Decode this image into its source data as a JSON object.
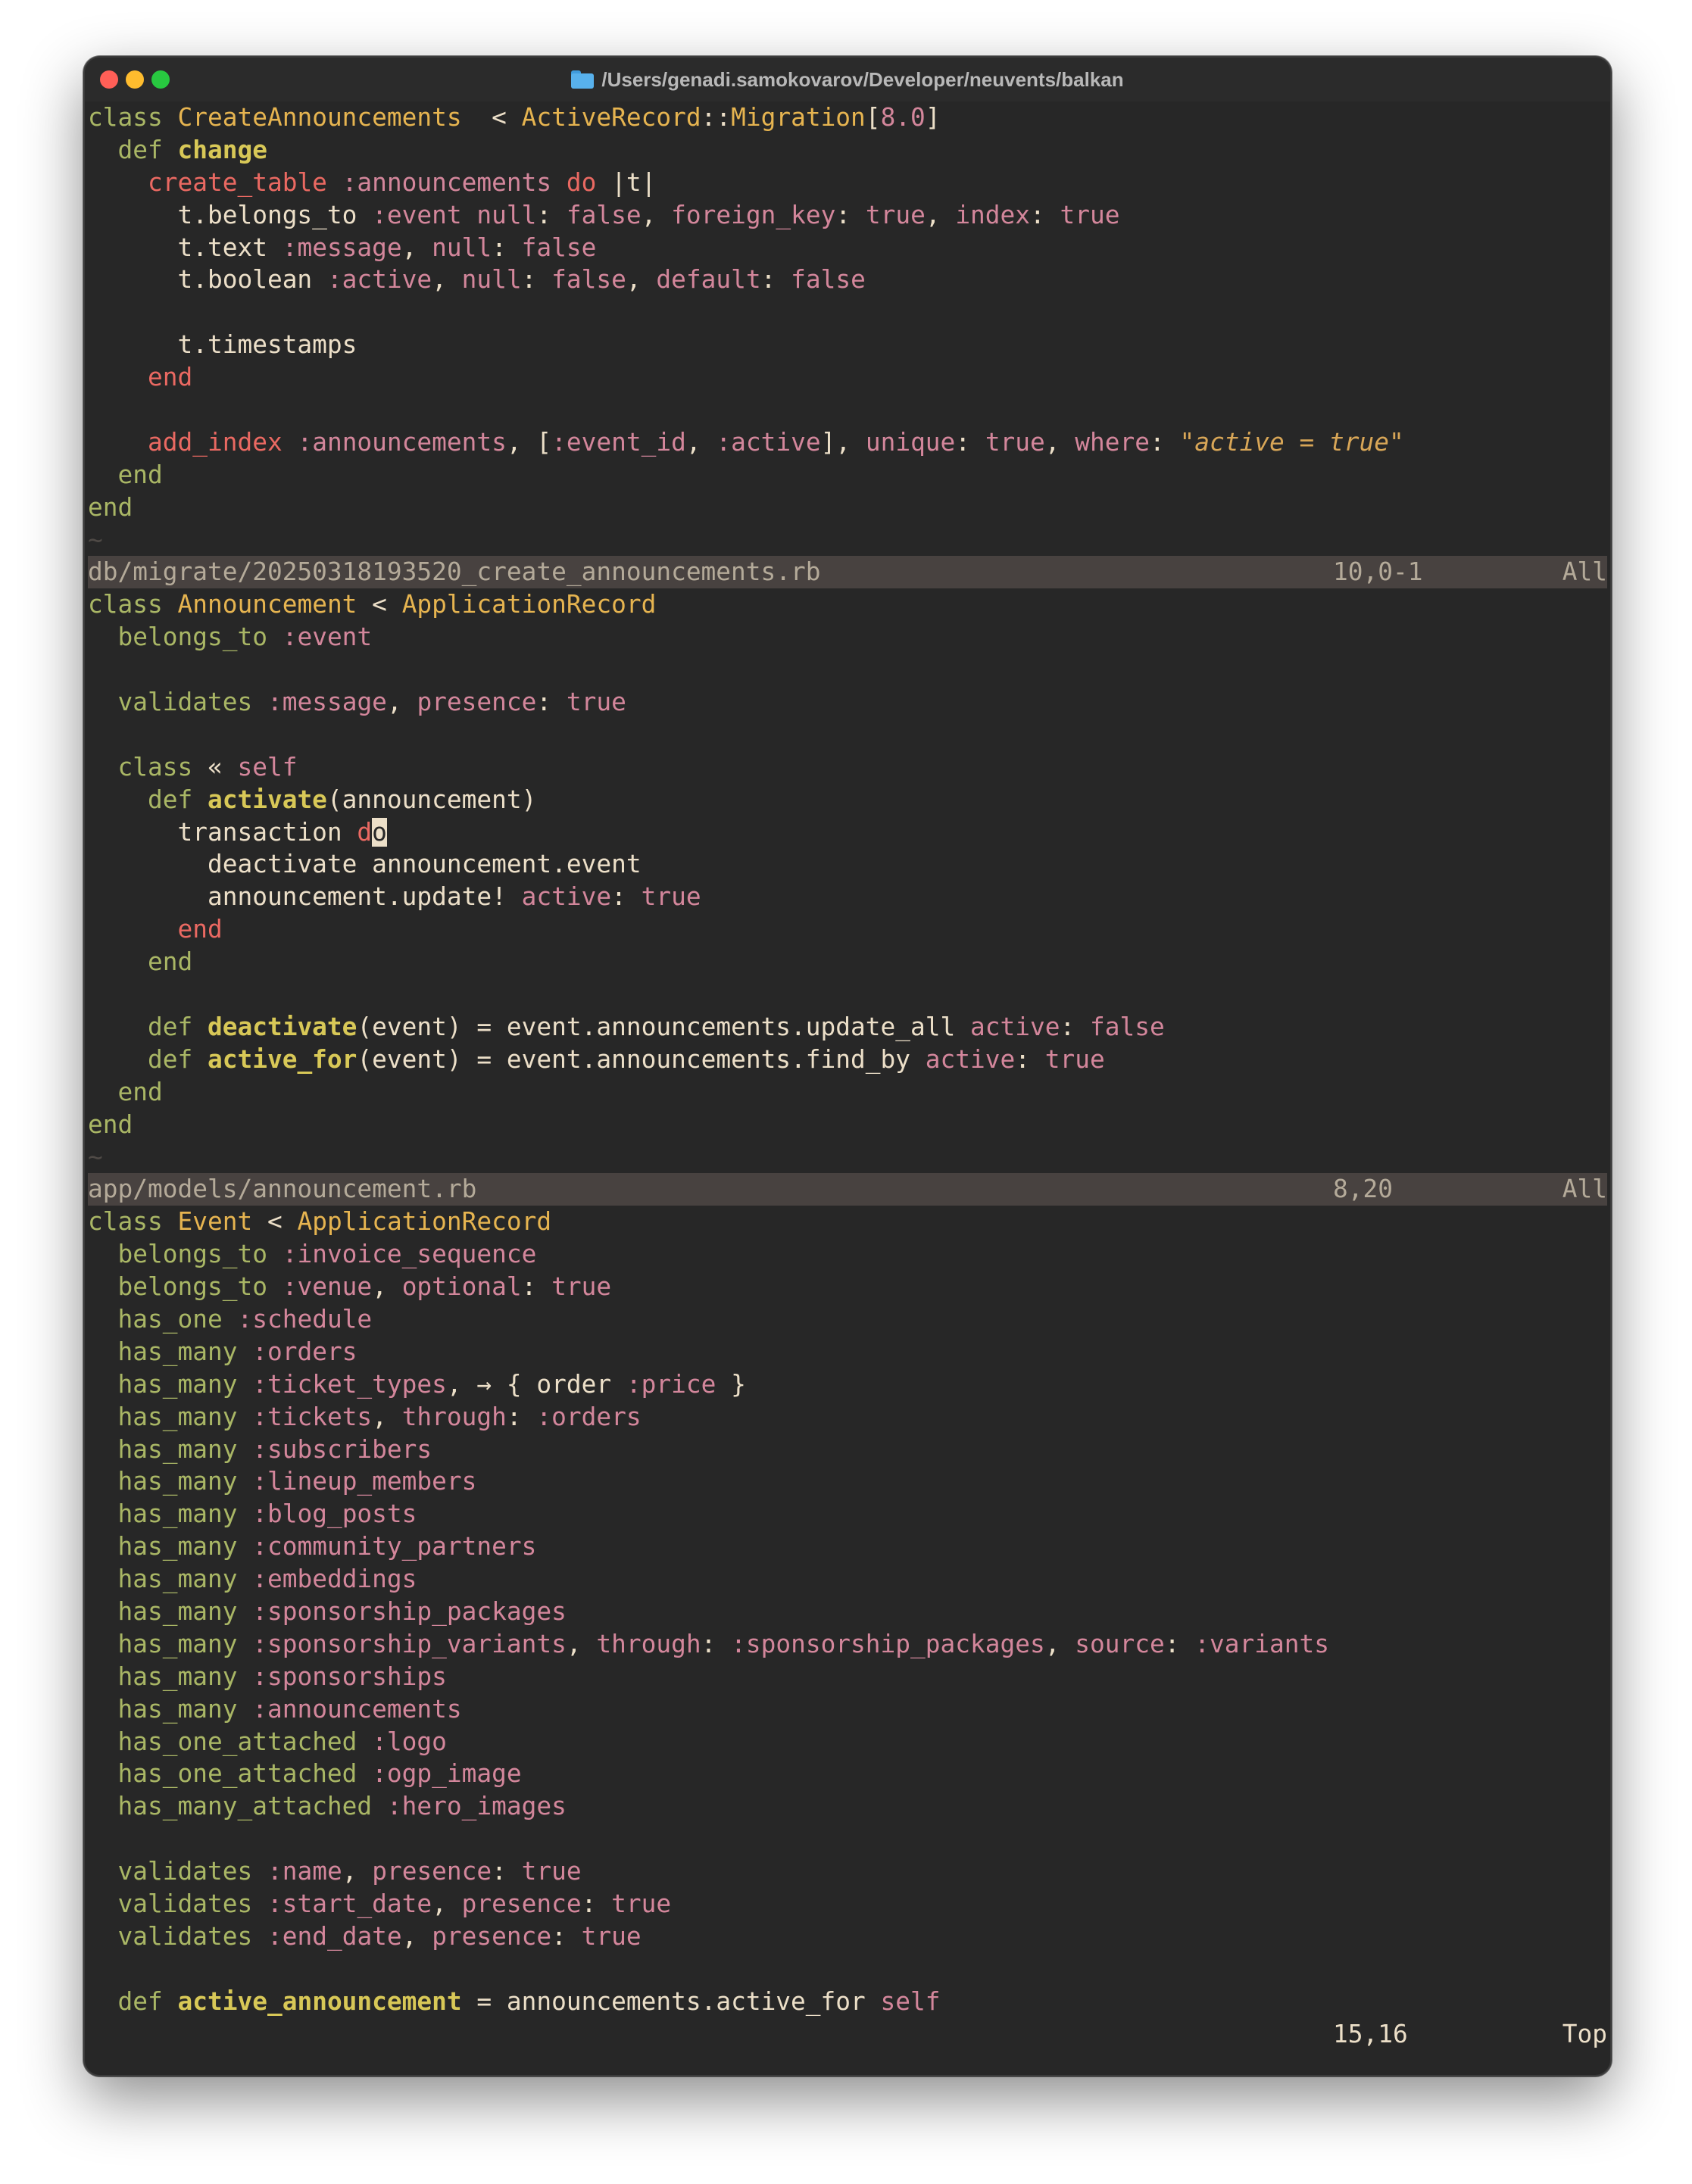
{
  "window": {
    "title": "/Users/genadi.samokovarov/Developer/neuvents/balkan"
  },
  "colors": {
    "background": "#272727",
    "statusline": "#484240",
    "keyword": "#a9b665",
    "control": "#ea6962",
    "constant": "#e6b450",
    "symbol": "#d3869b",
    "function": "#d8c857",
    "text": "#ecdfc8"
  },
  "panes": [
    {
      "filename": "db/migrate/20250318193520_create_announcements.rb",
      "position": "10,0-1",
      "scroll": "All"
    },
    {
      "filename": "app/models/announcement.rb",
      "position": "8,20",
      "scroll": "All"
    },
    {
      "filename": "",
      "position": "15,16",
      "scroll": "Top"
    }
  ],
  "code": [
    [
      [
        "kw",
        "class "
      ],
      [
        "const",
        "CreateAnnouncements"
      ],
      [
        "",
        "  < "
      ],
      [
        "const",
        "ActiveRecord"
      ],
      [
        "",
        "::"
      ],
      [
        "const",
        "Migration"
      ],
      [
        "",
        "["
      ],
      [
        "num",
        "8.0"
      ],
      [
        "",
        "]"
      ]
    ],
    [
      [
        "",
        "  "
      ],
      [
        "kw",
        "def "
      ],
      [
        "fn",
        "change"
      ]
    ],
    [
      [
        "",
        "    "
      ],
      [
        "ctl",
        "create_table "
      ],
      [
        "sym",
        ":announcements "
      ],
      [
        "ctl",
        "do "
      ],
      [
        "",
        "|t|"
      ]
    ],
    [
      [
        "",
        "      t.belongs_to "
      ],
      [
        "sym",
        ":event"
      ],
      [
        "",
        " "
      ],
      [
        "sym",
        "null"
      ],
      [
        "",
        ": "
      ],
      [
        "bool",
        "false"
      ],
      [
        "",
        ", "
      ],
      [
        "sym",
        "foreign_key"
      ],
      [
        "",
        ": "
      ],
      [
        "bool",
        "true"
      ],
      [
        "",
        ", "
      ],
      [
        "sym",
        "index"
      ],
      [
        "",
        ": "
      ],
      [
        "bool",
        "true"
      ]
    ],
    [
      [
        "",
        "      t.text "
      ],
      [
        "sym",
        ":message"
      ],
      [
        "",
        ", "
      ],
      [
        "sym",
        "null"
      ],
      [
        "",
        ": "
      ],
      [
        "bool",
        "false"
      ]
    ],
    [
      [
        "",
        "      t.boolean "
      ],
      [
        "sym",
        ":active"
      ],
      [
        "",
        ", "
      ],
      [
        "sym",
        "null"
      ],
      [
        "",
        ": "
      ],
      [
        "bool",
        "false"
      ],
      [
        "",
        ", "
      ],
      [
        "sym",
        "default"
      ],
      [
        "",
        ": "
      ],
      [
        "bool",
        "false"
      ]
    ],
    [
      [
        "",
        ""
      ]
    ],
    [
      [
        "",
        "      t.timestamps"
      ]
    ],
    [
      [
        "",
        "    "
      ],
      [
        "ctl",
        "end"
      ]
    ],
    [
      [
        "",
        ""
      ]
    ],
    [
      [
        "",
        "    "
      ],
      [
        "ctl",
        "add_index "
      ],
      [
        "sym",
        ":announcements"
      ],
      [
        "",
        ", ["
      ],
      [
        "sym",
        ":event_id"
      ],
      [
        "",
        ", "
      ],
      [
        "sym",
        ":active"
      ],
      [
        "",
        "], "
      ],
      [
        "sym",
        "unique"
      ],
      [
        "",
        ": "
      ],
      [
        "bool",
        "true"
      ],
      [
        "",
        ", "
      ],
      [
        "sym",
        "where"
      ],
      [
        "",
        ": "
      ],
      [
        "str",
        "\""
      ],
      [
        "stri",
        "active = true"
      ],
      [
        "str",
        "\""
      ]
    ],
    [
      [
        "",
        "  "
      ],
      [
        "kw",
        "end"
      ]
    ],
    [
      [
        "kw",
        "end"
      ]
    ],
    [
      [
        "tilde",
        "~"
      ]
    ],
    [
      [
        "status",
        "0"
      ]
    ],
    [
      [
        "kw",
        "class "
      ],
      [
        "const",
        "Announcement"
      ],
      [
        "",
        " < "
      ],
      [
        "const",
        "ApplicationRecord"
      ]
    ],
    [
      [
        "",
        "  "
      ],
      [
        "kw",
        "belongs_to "
      ],
      [
        "sym",
        ":event"
      ]
    ],
    [
      [
        "",
        ""
      ]
    ],
    [
      [
        "",
        "  "
      ],
      [
        "kw",
        "validates "
      ],
      [
        "sym",
        ":message"
      ],
      [
        "",
        ", "
      ],
      [
        "sym",
        "presence"
      ],
      [
        "",
        ": "
      ],
      [
        "bool",
        "true"
      ]
    ],
    [
      [
        "",
        ""
      ]
    ],
    [
      [
        "",
        "  "
      ],
      [
        "kw",
        "class "
      ],
      [
        "",
        "« "
      ],
      [
        "sym",
        "self"
      ]
    ],
    [
      [
        "",
        "    "
      ],
      [
        "kw",
        "def "
      ],
      [
        "fn",
        "activate"
      ],
      [
        "",
        "(announcement)"
      ]
    ],
    [
      [
        "",
        "      transaction "
      ],
      [
        "ctl",
        "d"
      ],
      [
        "cursor",
        "o"
      ]
    ],
    [
      [
        "",
        "        deactivate announcement.event"
      ]
    ],
    [
      [
        "",
        "        announcement.update! "
      ],
      [
        "sym",
        "active"
      ],
      [
        "",
        ": "
      ],
      [
        "bool",
        "true"
      ]
    ],
    [
      [
        "",
        "      "
      ],
      [
        "ctl",
        "end"
      ]
    ],
    [
      [
        "",
        "    "
      ],
      [
        "kw",
        "end"
      ]
    ],
    [
      [
        "",
        ""
      ]
    ],
    [
      [
        "",
        "    "
      ],
      [
        "kw",
        "def "
      ],
      [
        "fn",
        "deactivate"
      ],
      [
        "",
        "(event) = event.announcements.update_all "
      ],
      [
        "sym",
        "active"
      ],
      [
        "",
        ": "
      ],
      [
        "bool",
        "false"
      ]
    ],
    [
      [
        "",
        "    "
      ],
      [
        "kw",
        "def "
      ],
      [
        "fn",
        "active_for"
      ],
      [
        "",
        "(event) = event.announcements.find_by "
      ],
      [
        "sym",
        "active"
      ],
      [
        "",
        ": "
      ],
      [
        "bool",
        "true"
      ]
    ],
    [
      [
        "",
        "  "
      ],
      [
        "kw",
        "end"
      ]
    ],
    [
      [
        "kw",
        "end"
      ]
    ],
    [
      [
        "tilde",
        "~"
      ]
    ],
    [
      [
        "status",
        "1"
      ]
    ],
    [
      [
        "kw",
        "class "
      ],
      [
        "const",
        "Event"
      ],
      [
        "",
        " < "
      ],
      [
        "const",
        "ApplicationRecord"
      ]
    ],
    [
      [
        "",
        "  "
      ],
      [
        "kw",
        "belongs_to "
      ],
      [
        "sym",
        ":invoice_sequence"
      ]
    ],
    [
      [
        "",
        "  "
      ],
      [
        "kw",
        "belongs_to "
      ],
      [
        "sym",
        ":venue"
      ],
      [
        "",
        ", "
      ],
      [
        "sym",
        "optional"
      ],
      [
        "",
        ": "
      ],
      [
        "bool",
        "true"
      ]
    ],
    [
      [
        "",
        "  "
      ],
      [
        "kw",
        "has_one "
      ],
      [
        "sym",
        ":schedule"
      ]
    ],
    [
      [
        "",
        "  "
      ],
      [
        "kw",
        "has_many "
      ],
      [
        "sym",
        ":orders"
      ]
    ],
    [
      [
        "",
        "  "
      ],
      [
        "kw",
        "has_many "
      ],
      [
        "sym",
        ":ticket_types"
      ],
      [
        "",
        ", → { order "
      ],
      [
        "sym",
        ":price"
      ],
      [
        "",
        " }"
      ]
    ],
    [
      [
        "",
        "  "
      ],
      [
        "kw",
        "has_many "
      ],
      [
        "sym",
        ":tickets"
      ],
      [
        "",
        ", "
      ],
      [
        "sym",
        "through"
      ],
      [
        "",
        ": "
      ],
      [
        "sym",
        ":orders"
      ]
    ],
    [
      [
        "",
        "  "
      ],
      [
        "kw",
        "has_many "
      ],
      [
        "sym",
        ":subscribers"
      ]
    ],
    [
      [
        "",
        "  "
      ],
      [
        "kw",
        "has_many "
      ],
      [
        "sym",
        ":lineup_members"
      ]
    ],
    [
      [
        "",
        "  "
      ],
      [
        "kw",
        "has_many "
      ],
      [
        "sym",
        ":blog_posts"
      ]
    ],
    [
      [
        "",
        "  "
      ],
      [
        "kw",
        "has_many "
      ],
      [
        "sym",
        ":community_partners"
      ]
    ],
    [
      [
        "",
        "  "
      ],
      [
        "kw",
        "has_many "
      ],
      [
        "sym",
        ":embeddings"
      ]
    ],
    [
      [
        "",
        "  "
      ],
      [
        "kw",
        "has_many "
      ],
      [
        "sym",
        ":sponsorship_packages"
      ]
    ],
    [
      [
        "",
        "  "
      ],
      [
        "kw",
        "has_many "
      ],
      [
        "sym",
        ":sponsorship_variants"
      ],
      [
        "",
        ", "
      ],
      [
        "sym",
        "through"
      ],
      [
        "",
        ": "
      ],
      [
        "sym",
        ":sponsorship_packages"
      ],
      [
        "",
        ", "
      ],
      [
        "sym",
        "source"
      ],
      [
        "",
        ": "
      ],
      [
        "sym",
        ":variants"
      ]
    ],
    [
      [
        "",
        "  "
      ],
      [
        "kw",
        "has_many "
      ],
      [
        "sym",
        ":sponsorships"
      ]
    ],
    [
      [
        "",
        "  "
      ],
      [
        "kw",
        "has_many "
      ],
      [
        "sym",
        ":announcements"
      ]
    ],
    [
      [
        "",
        "  "
      ],
      [
        "kw",
        "has_one_attached "
      ],
      [
        "sym",
        ":logo"
      ]
    ],
    [
      [
        "",
        "  "
      ],
      [
        "kw",
        "has_one_attached "
      ],
      [
        "sym",
        ":ogp_image"
      ]
    ],
    [
      [
        "",
        "  "
      ],
      [
        "kw",
        "has_many_attached "
      ],
      [
        "sym",
        ":hero_images"
      ]
    ],
    [
      [
        "",
        ""
      ]
    ],
    [
      [
        "",
        "  "
      ],
      [
        "kw",
        "validates "
      ],
      [
        "sym",
        ":name"
      ],
      [
        "",
        ", "
      ],
      [
        "sym",
        "presence"
      ],
      [
        "",
        ": "
      ],
      [
        "bool",
        "true"
      ]
    ],
    [
      [
        "",
        "  "
      ],
      [
        "kw",
        "validates "
      ],
      [
        "sym",
        ":start_date"
      ],
      [
        "",
        ", "
      ],
      [
        "sym",
        "presence"
      ],
      [
        "",
        ": "
      ],
      [
        "bool",
        "true"
      ]
    ],
    [
      [
        "",
        "  "
      ],
      [
        "kw",
        "validates "
      ],
      [
        "sym",
        ":end_date"
      ],
      [
        "",
        ", "
      ],
      [
        "sym",
        "presence"
      ],
      [
        "",
        ": "
      ],
      [
        "bool",
        "true"
      ]
    ],
    [
      [
        "",
        ""
      ]
    ],
    [
      [
        "",
        "  "
      ],
      [
        "kw",
        "def "
      ],
      [
        "fn",
        "active_announcement"
      ],
      [
        "",
        " = announcements.active_for "
      ],
      [
        "sym",
        "self"
      ]
    ],
    [
      [
        "statusplain",
        "2"
      ]
    ]
  ]
}
